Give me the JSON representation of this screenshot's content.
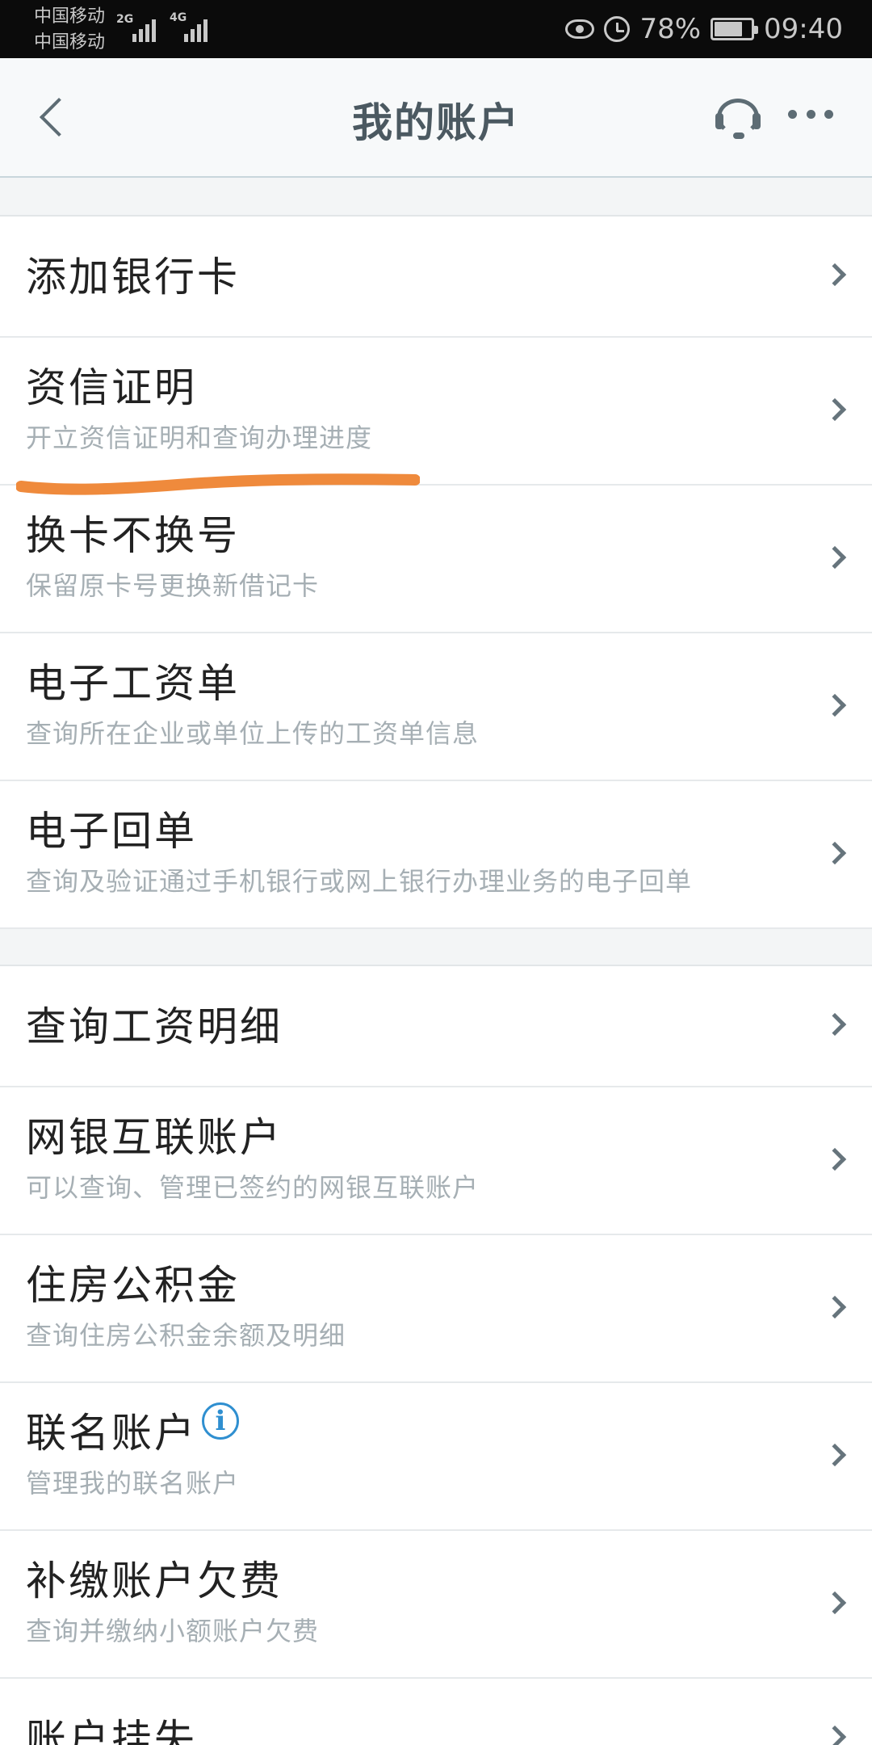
{
  "status_bar": {
    "carrier_1": "中国移动",
    "carrier_2": "中国移动",
    "network_1": "2G",
    "network_2": "4G",
    "battery": "78%",
    "battery_level": 0.78,
    "time": "09:40"
  },
  "nav": {
    "title": "我的账户",
    "icons": [
      "back-icon",
      "headset-icon",
      "more-icon"
    ]
  },
  "groups": [
    {
      "items": [
        {
          "title": "添加银行卡"
        },
        {
          "title": "资信证明",
          "subtitle": "开立资信证明和查询办理进度"
        },
        {
          "title": "换卡不换号",
          "subtitle": "保留原卡号更换新借记卡"
        },
        {
          "title": "电子工资单",
          "subtitle": "查询所在企业或单位上传的工资单信息"
        },
        {
          "title": "电子回单",
          "subtitle": "查询及验证通过手机银行或网上银行办理业务的电子回单"
        }
      ]
    },
    {
      "items": [
        {
          "title": "查询工资明细"
        },
        {
          "title": "网银互联账户",
          "subtitle": "可以查询、管理已签约的网银互联账户"
        },
        {
          "title": "住房公积金",
          "subtitle": "查询住房公积金余额及明细"
        },
        {
          "title": "联名账户",
          "subtitle": "管理我的联名账户",
          "info_icon": "i"
        },
        {
          "title": "补缴账户欠费",
          "subtitle": "查询并缴纳小额账户欠费"
        },
        {
          "title": "账户挂失"
        }
      ]
    }
  ],
  "colors": {
    "underline": "#ef8a3c",
    "info": "#2f8fd0"
  }
}
